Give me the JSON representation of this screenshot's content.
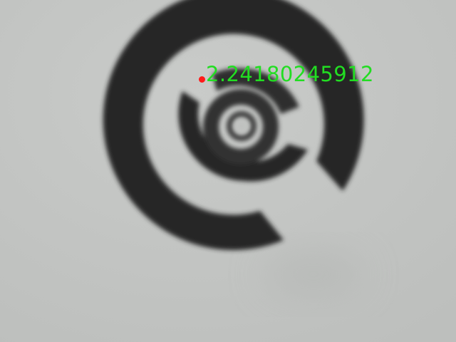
{
  "overlay": {
    "readout_text": "2.24180245912",
    "readout_color": "#22dd22",
    "marker_color": "#ff1a1a"
  },
  "scene": {
    "subject": "blurred-spiral-target-icon",
    "background_color": "#c4c6c4",
    "ink_color": "#262626"
  }
}
